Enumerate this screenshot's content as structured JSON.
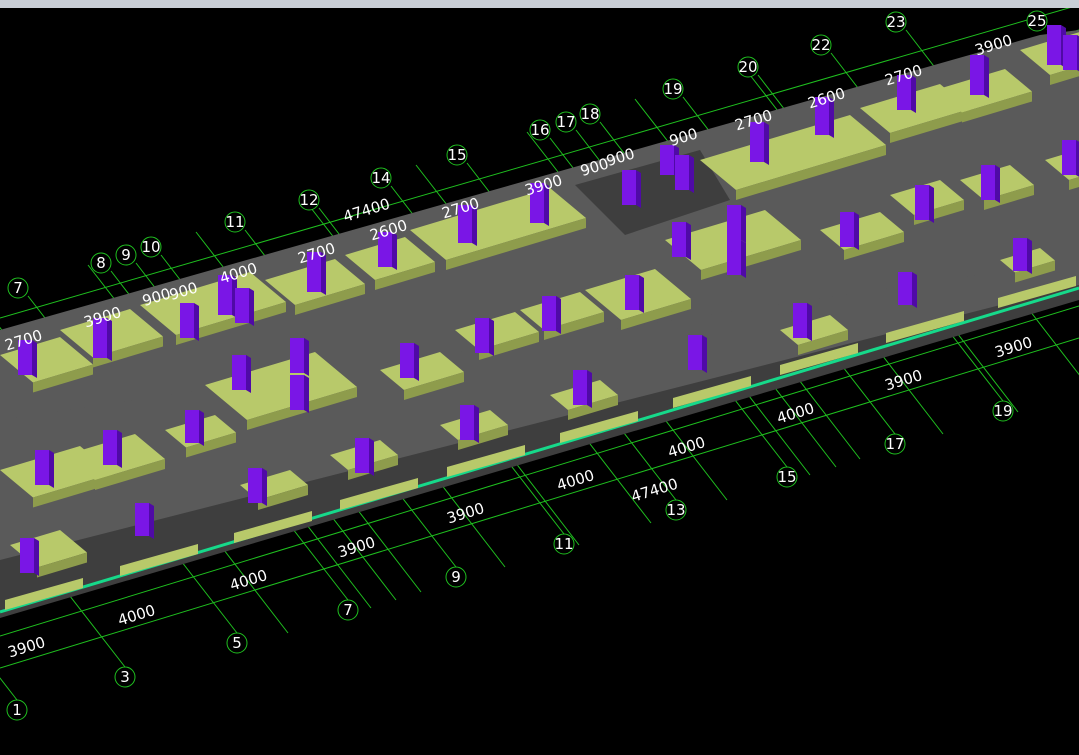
{
  "colors": {
    "background": "#000000",
    "grid_line": "#1fbf1f",
    "slab": "#5a5a5a",
    "slab_dark": "#3e3e3e",
    "pile_cap": "#b8c96a",
    "pile_cap_side": "#8e9c4c",
    "column": "#7a16e6",
    "column_dark": "#4f0aa6",
    "edge_line": "#16d98a",
    "text": "#ffffff"
  },
  "grid_bubbles_bottom": [
    "1",
    "3",
    "5",
    "7",
    "9",
    "11",
    "13",
    "15",
    "17",
    "19"
  ],
  "grid_bubbles_top": [
    "7",
    "8",
    "9",
    "10",
    "11",
    "12",
    "14",
    "15",
    "16",
    "17",
    "18",
    "19",
    "20",
    "22",
    "23",
    "25"
  ],
  "dims_bottom": [
    "3900",
    "4000",
    "4000",
    "3900",
    "3900",
    "4000",
    "4000",
    "4000",
    "3900",
    "3900",
    "4000"
  ],
  "dim_bottom_total": "47400",
  "dims_top": [
    "2700",
    "3900",
    "900",
    "900",
    "4000",
    "2700",
    "2600",
    "2700",
    "3900",
    "900",
    "900",
    "900",
    "2700",
    "2600",
    "2700",
    "3900"
  ],
  "dim_top_total": "47400"
}
